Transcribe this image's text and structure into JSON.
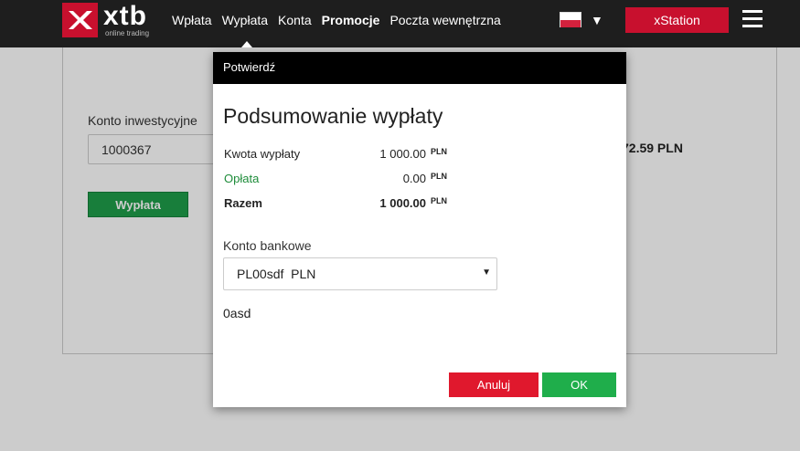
{
  "header": {
    "logo_word": "xtb",
    "logo_sub": "online trading",
    "nav": [
      {
        "label": "Wpłata"
      },
      {
        "label": "Wypłata"
      },
      {
        "label": "Konta"
      },
      {
        "label": "Promocje"
      },
      {
        "label": "Poczta wewnętrzna"
      }
    ],
    "language_caret": "▼",
    "xstation_label": "xStation"
  },
  "background": {
    "account_label": "Konto inwestycyjne",
    "account_value": "1000367",
    "balance_partial": "72.59 PLN",
    "withdraw_button": "Wypłata"
  },
  "modal": {
    "header": "Potwierdź",
    "title": "Podsumowanie wypłaty",
    "rows": [
      {
        "label": "Kwota wypłaty",
        "value": "1 000.00",
        "currency": "PLN"
      },
      {
        "label": "Opłata",
        "value": "0.00",
        "currency": "PLN"
      },
      {
        "label": "Razem",
        "value": "1 000.00",
        "currency": "PLN"
      }
    ],
    "bank_label": "Konto bankowe",
    "bank_selected": "PL00sdf  PLN",
    "bank_caret": "▼",
    "note": "0asd",
    "cancel_label": "Anuluj",
    "ok_label": "OK"
  },
  "colors": {
    "topbar": "#1e1e1e",
    "brand_red": "#c8102e",
    "ok_green": "#1fae4b",
    "fee_green": "#1e8c3a"
  }
}
